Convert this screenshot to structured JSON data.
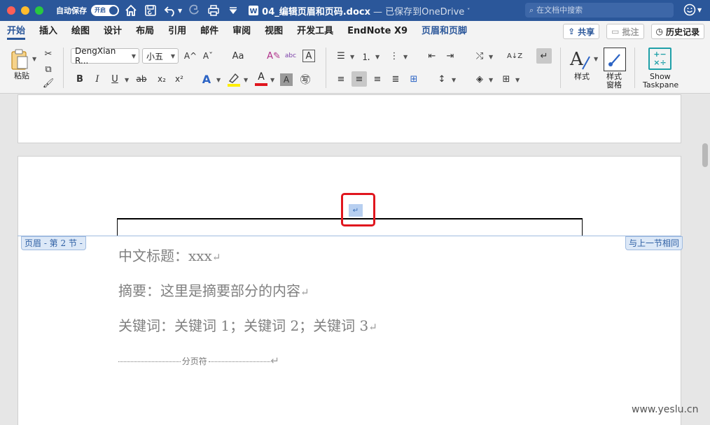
{
  "titlebar": {
    "autosave_label": "自动保存",
    "autosave_toggle": "开启",
    "file_name": "04_编辑页眉和页码.docx",
    "save_status": "— 已保存到OneDrive",
    "search_placeholder": "在文档中搜索"
  },
  "menu": {
    "tabs": [
      "开始",
      "插入",
      "绘图",
      "设计",
      "布局",
      "引用",
      "邮件",
      "审阅",
      "视图",
      "开发工具",
      "EndNote X9",
      "页眉和页脚"
    ],
    "share": "共享",
    "comments": "批注",
    "history": "历史记录"
  },
  "ribbon": {
    "paste_label": "粘贴",
    "font_name": "DengXian R...",
    "font_size": "小五",
    "styles_label": "样式",
    "styles_pane_label_1": "样式",
    "styles_pane_label_2": "窗格",
    "taskpane_label_1": "Show",
    "taskpane_label_2": "Taskpane",
    "bold": "B",
    "italic": "I",
    "underline": "U",
    "strike": "ab",
    "sub": "x₂",
    "sup": "x²",
    "grow": "A^",
    "shrink": "Aˇ",
    "case": "Aa",
    "abc": "abc",
    "boxA": "A",
    "highlight_a": "A",
    "shade_a": "A",
    "sort": "A↓Z"
  },
  "document": {
    "header_tag": "页眉 - 第 2 节 -",
    "same_as_previous": "与上一节相同",
    "paragraph_mark": "↵",
    "line1": "中文标题：xxx",
    "line2": "摘要：这里是摘要部分的内容",
    "line3": "关键词：关键词 1；关键词 2；关键词 3",
    "page_break": "分页符"
  },
  "watermark": "www.yeslu.cn",
  "colors": {
    "titlebar": "#2b579a",
    "accent": "#2b579a",
    "highlight": "#b7cff0",
    "redbox": "#e0161e"
  }
}
